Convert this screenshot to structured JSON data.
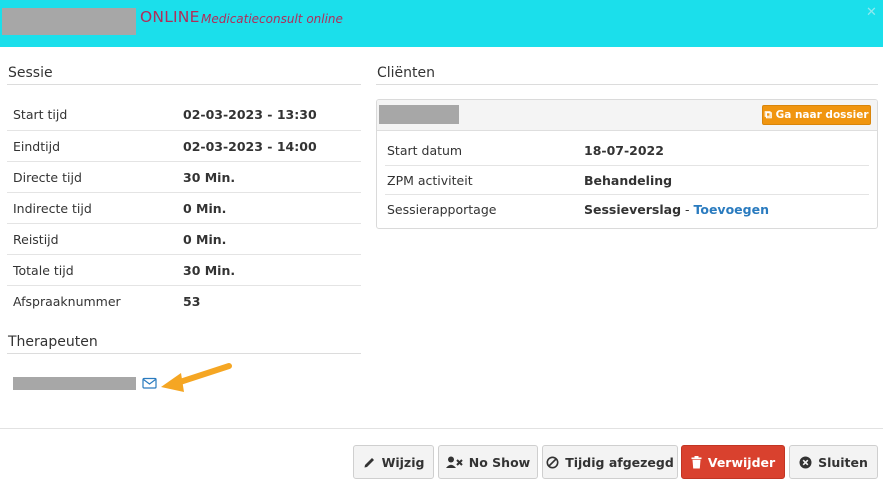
{
  "header": {
    "title": "ONLINE",
    "subtitle": "Medicatieconsult online",
    "close_icon": "close-icon"
  },
  "sessie": {
    "title": "Sessie",
    "rows": [
      {
        "label": "Start tijd",
        "value": "02-03-2023 - 13:30"
      },
      {
        "label": "Eindtijd",
        "value": "02-03-2023 - 14:00"
      },
      {
        "label": "Directe tijd",
        "value": "30 Min."
      },
      {
        "label": "Indirecte tijd",
        "value": "0 Min."
      },
      {
        "label": "Reistijd",
        "value": "0 Min."
      },
      {
        "label": "Totale tijd",
        "value": "30 Min."
      },
      {
        "label": "Afspraaknummer",
        "value": "53"
      }
    ]
  },
  "therapeuten": {
    "title": "Therapeuten",
    "contact_icon": "envelope-icon"
  },
  "clienten": {
    "title": "Cliënten",
    "dossier_button": "Ga naar dossier",
    "rows": [
      {
        "label": "Start datum",
        "value": "18-07-2022"
      },
      {
        "label": "ZPM activiteit",
        "value": "Behandeling"
      },
      {
        "label": "Sessierapportage",
        "value": "Sessieverslag",
        "separator": " - ",
        "link": "Toevoegen"
      }
    ]
  },
  "footer": {
    "buttons": [
      {
        "label": "Wijzig",
        "icon": "pencil-icon"
      },
      {
        "label": "No Show",
        "icon": "user-times-icon"
      },
      {
        "label": "Tijdig afgezegd",
        "icon": "ban-icon"
      },
      {
        "label": "Verwijder",
        "icon": "trash-icon"
      },
      {
        "label": "Sluiten",
        "icon": "times-circle-icon"
      }
    ]
  },
  "colors": {
    "header_bg": "#1bdfeb",
    "header_text": "#b02e5a",
    "accent_orange": "#f0950f",
    "danger": "#d9412e",
    "link": "#2a7bbf"
  }
}
